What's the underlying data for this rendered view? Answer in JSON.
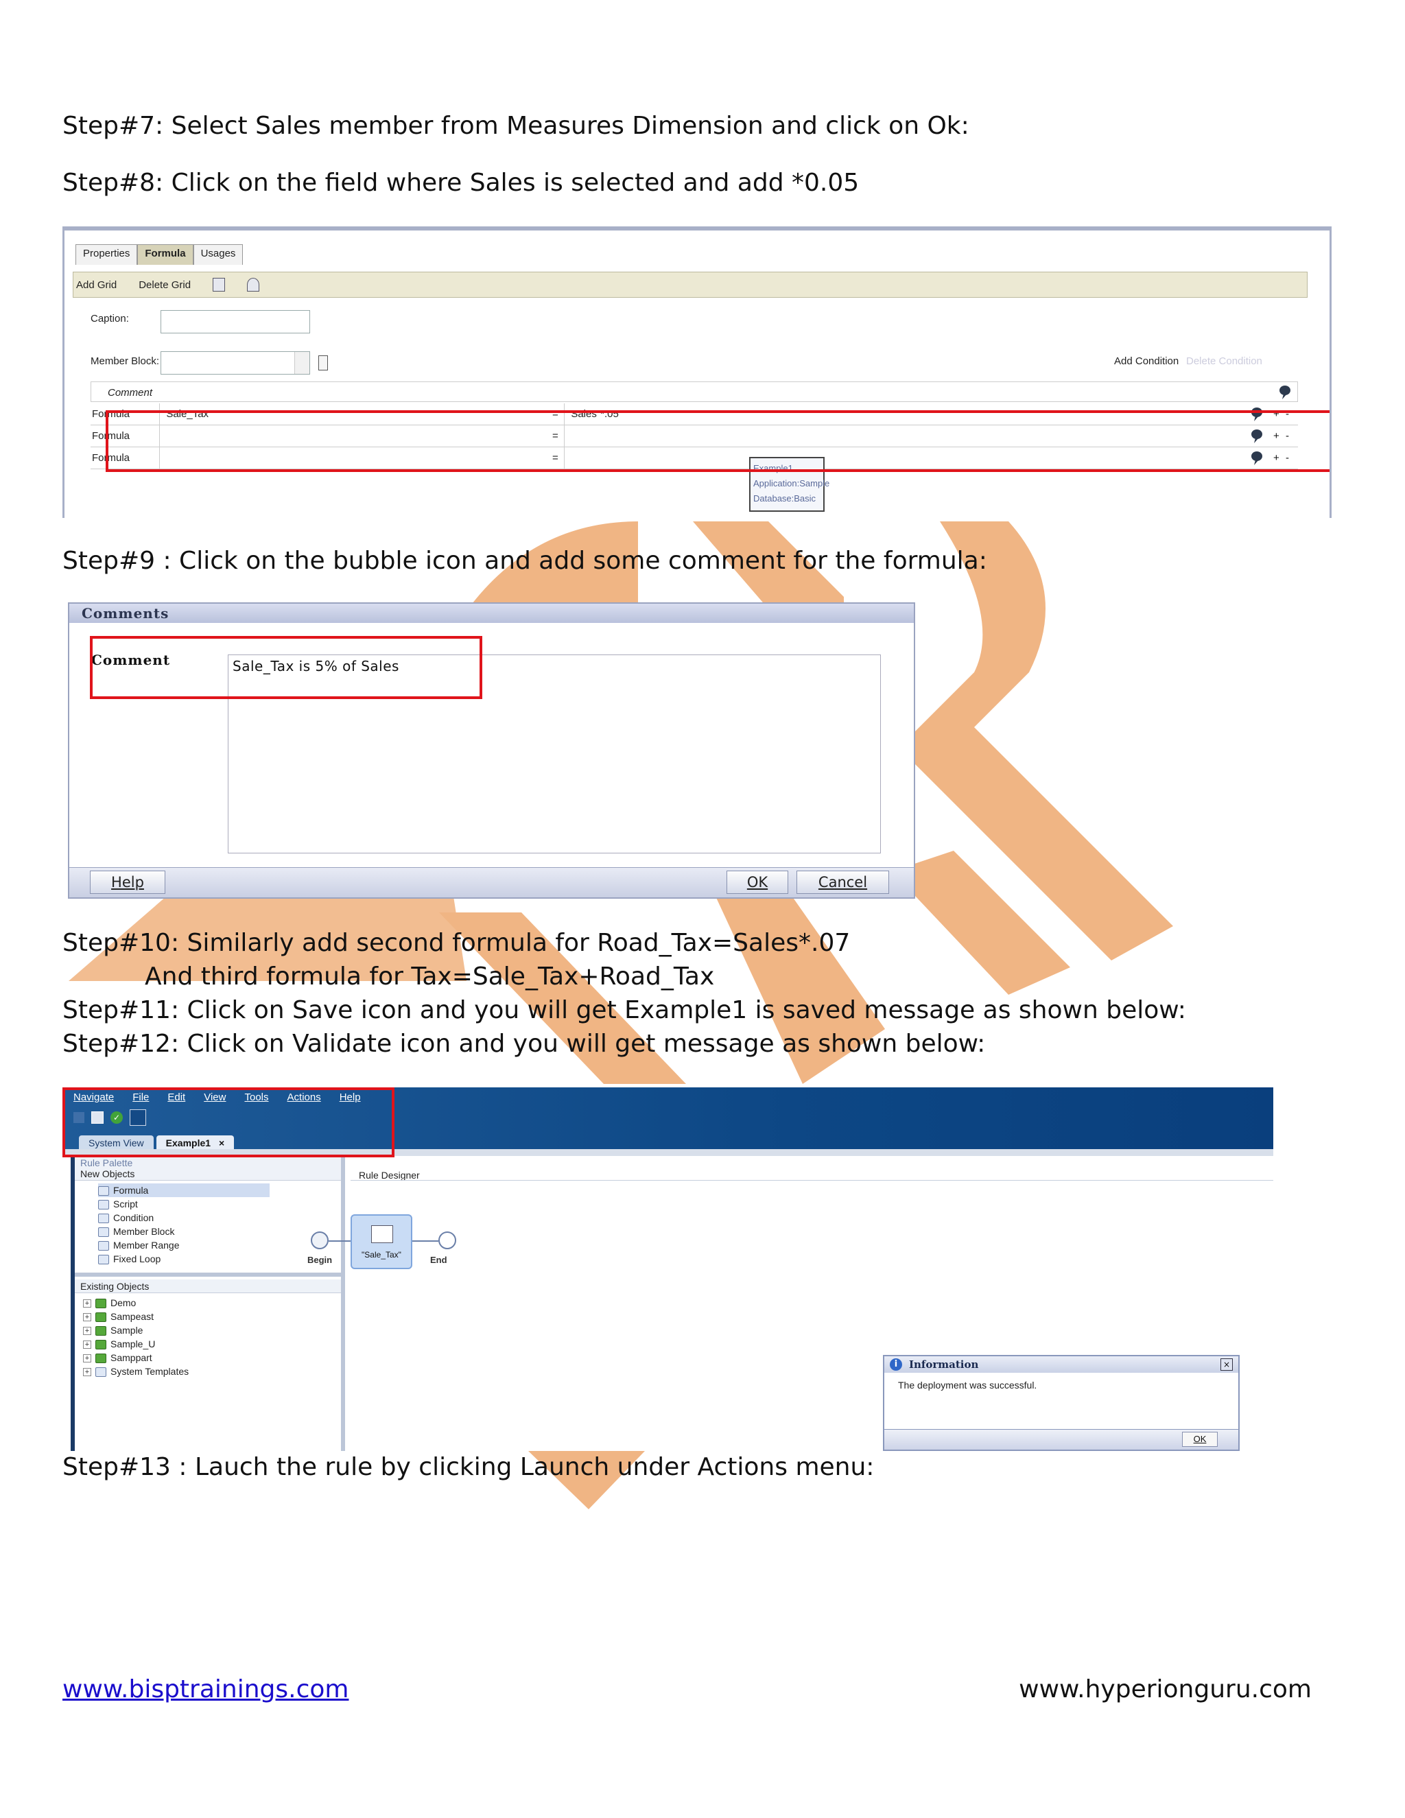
{
  "steps": {
    "step7": "Step#7: Select Sales member from Measures Dimension and click on Ok:",
    "step8": "Step#8: Click on the field where Sales is selected and add *0.05",
    "step9": "Step#9 : Click on the bubble icon and add some comment for the formula:",
    "step10a": "Step#10: Similarly add second formula for Road_Tax=Sales*.07",
    "step10b": "And third formula for Tax=Sale_Tax+Road_Tax",
    "step11": "Step#11: Click on Save icon and you will get Example1 is saved message as shown below:",
    "step12": "Step#12: Click on Validate icon and you will get message as shown below:",
    "step13": "Step#13 : Lauch the rule by clicking Launch under Actions menu:"
  },
  "formula_screen": {
    "tabs": [
      "Properties",
      "Formula",
      "Usages"
    ],
    "toolbar": [
      "Add Grid",
      "Delete Grid"
    ],
    "caption_label": "Caption:",
    "member_block_label": "Member Block:",
    "add_condition": "Add Condition",
    "delete_condition": "Delete Condition",
    "comment_header": "Comment",
    "rows": [
      {
        "label": "Formula",
        "target": "\"Sale_Tax\"",
        "eq": "=",
        "expr": "\"Sales\"*.05"
      },
      {
        "label": "Formula",
        "target": "",
        "eq": "=",
        "expr": ""
      },
      {
        "label": "Formula",
        "target": "",
        "eq": "=",
        "expr": ""
      }
    ],
    "tooltip": [
      "Example1",
      "Application:Sample",
      "Database:Basic"
    ],
    "plus": "+",
    "minus": "-"
  },
  "comments_dialog": {
    "title": "Comments",
    "label": "Comment",
    "value": "Sale_Tax is 5% of Sales",
    "help": "Help",
    "ok": "OK",
    "cancel": "Cancel"
  },
  "rule_designer": {
    "menu": [
      "Navigate",
      "File",
      "Edit",
      "View",
      "Tools",
      "Actions",
      "Help"
    ],
    "tabs": [
      "System View",
      "Example1"
    ],
    "tab_close": "×",
    "palette_title": "Rule Palette",
    "new_objects": "New Objects",
    "new_items": [
      "Formula",
      "Script",
      "Condition",
      "Member Block",
      "Member Range",
      "Fixed Loop"
    ],
    "existing_objects": "Existing Objects",
    "existing_items": [
      "Demo",
      "Sampeast",
      "Sample",
      "Sample_U",
      "Samppart",
      "System Templates"
    ],
    "designer_title": "Rule Designer",
    "begin": "Begin",
    "node": "\"Sale_Tax\"",
    "end": "End",
    "info_title": "Information",
    "info_message": "The deployment was successful.",
    "info_ok": "OK"
  },
  "footer": {
    "left": "www.bisptrainings.com",
    "right": "www.hyperionguru.com"
  },
  "colors": {
    "highlight": "#e0141b",
    "watermark": "#f0b27e",
    "app_blue": "#0d4785",
    "link": "#1a0dcc"
  }
}
